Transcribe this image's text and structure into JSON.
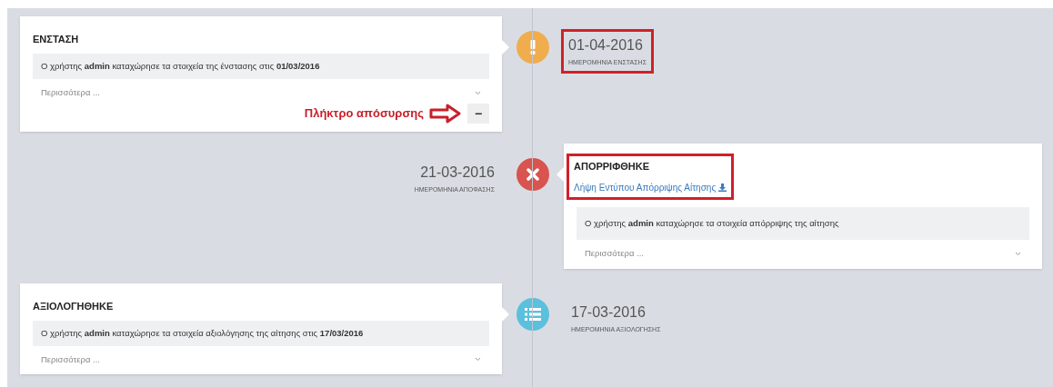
{
  "timeline": [
    {
      "on_left": true,
      "kind": "warning",
      "color": "#f0ad4e",
      "title": "ΕΝΣΤΑΣΗ",
      "note": "Ο χρήστης **admin** καταχώρησε τα στοιχεία της ένστασης στις **01/03/2016**",
      "more": "Περισσότερα ...",
      "date": "01-04-2016",
      "date_label": "ΗΜΕΡΟΜΗΝΙΑ ΕΝΣΤΑΣΗΣ",
      "date_highlighted": true,
      "heading_highlighted": false,
      "withdraw": {
        "callout": "Πλήκτρο απόσυρσης",
        "button": "−"
      }
    },
    {
      "on_left": false,
      "kind": "reject",
      "color": "#d9534f",
      "title": "ΑΠΟΡΡΙΦΘΗΚΕ",
      "link": "Λήψη Εντύπου Απόρριψης Αίτησης",
      "note": "Ο χρήστης **admin** καταχώρησε τα στοιχεία απόρριψης της αίτησης",
      "more": "Περισσότερα ...",
      "date": "21-03-2016",
      "date_label": "ΗΜΕΡΟΜΗΝΙΑ ΑΠΟΦΑΣΗΣ",
      "date_highlighted": false,
      "heading_highlighted": true
    },
    {
      "on_left": true,
      "kind": "list",
      "color": "#5bc0de",
      "title": "ΑΞΙΟΛΟΓΗΘΗΚΕ",
      "note": "Ο χρήστης **admin** καταχώρησε τα στοιχεία αξιολόγησης της αίτησης στις **17/03/2016**",
      "more": "Περισσότερα ...",
      "date": "17-03-2016",
      "date_label": "ΗΜΕΡΟΜΗΝΙΑ ΑΞΙΟΛΟΓΗΣΗΣ",
      "date_highlighted": false,
      "heading_highlighted": false
    }
  ]
}
